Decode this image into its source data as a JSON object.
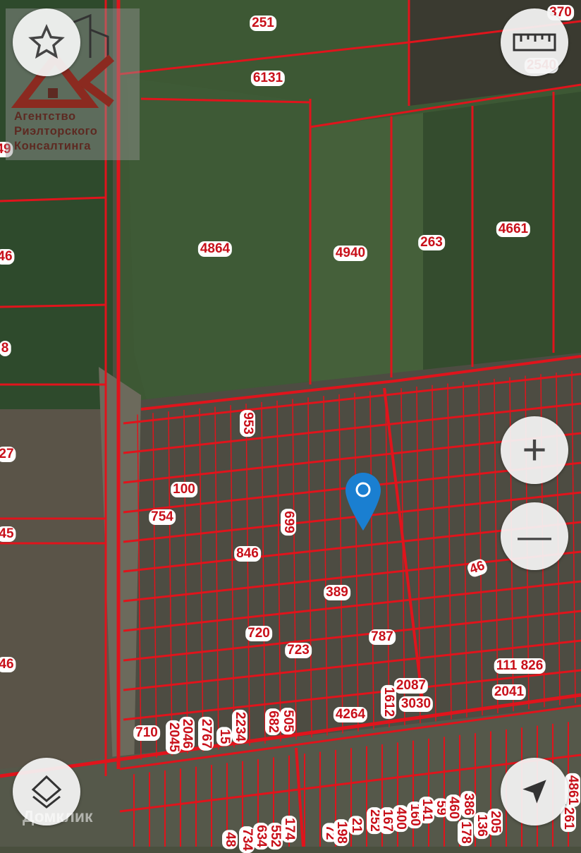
{
  "logo": {
    "lines": [
      "Агентство",
      "Риэлторского",
      "Консалтинга"
    ],
    "mark": "ARK"
  },
  "watermark": "Домклик",
  "controls": {
    "favorite": "star-icon",
    "ruler": "ruler-icon",
    "zoom_in": "+",
    "zoom_out": "—",
    "layers": "layers-icon",
    "locate": "navigation-arrow-icon"
  },
  "marker": {
    "icon": "map-pin-icon",
    "color": "#1a7fd1"
  },
  "colors": {
    "parcel_line": "#e0141c",
    "label_text": "#c8101a"
  },
  "parcel_labels": [
    "251",
    "6131",
    "370",
    "2540",
    "4864",
    "4940",
    "263",
    "4661",
    "49",
    "46",
    "8",
    "27",
    "45",
    "46",
    "953",
    "100",
    "754",
    "699",
    "846",
    "389",
    "720",
    "723",
    "787",
    "46",
    "111 826",
    "2041",
    "2087",
    "1612",
    "3030",
    "4264",
    "710",
    "2046",
    "2045",
    "2767",
    "15",
    "2234",
    "682",
    "505",
    "72",
    "198",
    "21",
    "252",
    "167",
    "400",
    "160",
    "141",
    "59",
    "460",
    "386",
    "178",
    "136",
    "205",
    "634",
    "552",
    "734",
    "174",
    "48",
    "4861",
    "261"
  ]
}
